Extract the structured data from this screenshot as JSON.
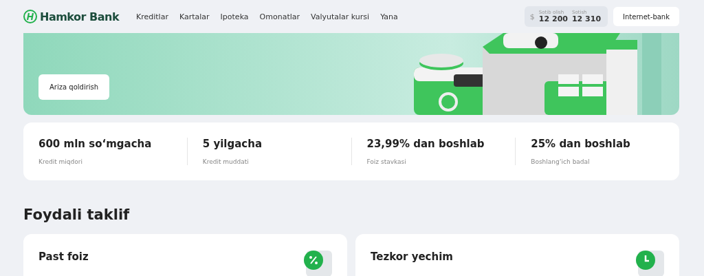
{
  "header": {
    "logo": "Hamkor Bank",
    "nav": [
      {
        "label": "Kreditlar"
      },
      {
        "label": "Kartalar"
      },
      {
        "label": "Ipoteka"
      },
      {
        "label": "Omonatlar"
      },
      {
        "label": "Valyutalar kursi"
      },
      {
        "label": "Yana"
      }
    ],
    "rates": {
      "symbol": "$",
      "buy_label": "Sotib olish",
      "buy": "12 200",
      "sell_label": "Sotish",
      "sell": "12 310"
    },
    "internet_bank": "Internet-bank"
  },
  "banner": {
    "button": "Ariza qoldirish"
  },
  "stats": [
    {
      "value": "600 mln so‘mgacha",
      "label": "Kredit miqdori"
    },
    {
      "value": "5 yilgacha",
      "label": "Kredit muddati"
    },
    {
      "value": "23,99% dan boshlab",
      "label": "Foiz stavkasi"
    },
    {
      "value": "25% dan boshlab",
      "label": "Boshlang‘ich badal"
    }
  ],
  "section": {
    "title": "Foydali taklif",
    "cards": [
      {
        "title": "Past foiz",
        "kind": "percent"
      },
      {
        "title": "Tezkor yechim",
        "kind": "clock"
      }
    ]
  }
}
